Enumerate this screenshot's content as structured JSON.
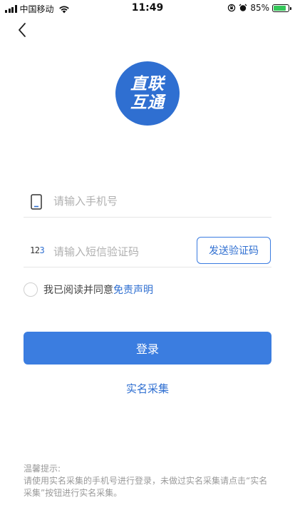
{
  "status_bar": {
    "carrier": "中国移动",
    "time": "11:49",
    "battery": "85%",
    "battery_level": 0.85
  },
  "logo": {
    "text": "直联互通",
    "color": "#2f6fd1"
  },
  "form": {
    "phone_placeholder": "请输入手机号",
    "phone_value": "",
    "sms_placeholder": "请输入短信验证码",
    "sms_value": "",
    "sms_icon_digits": "12",
    "sms_icon_accent": "3",
    "send_code_label": "发送验证码"
  },
  "agreement": {
    "text": "我已阅读并同意",
    "link": "免责声明",
    "checked": false
  },
  "actions": {
    "login_label": "登录",
    "realname_label": "实名采集",
    "accent": "#3b7de0"
  },
  "tips": {
    "title": "温馨提示:",
    "body": "请使用实名采集的手机号进行登录，未做过实名采集请点击“实名采集”按钮进行实名采集。"
  },
  "icons": {
    "back": "chevron-left-icon",
    "phone": "phone-icon",
    "sms": "sms-code-icon",
    "wifi": "wifi-icon",
    "alarm": "alarm-icon",
    "rotation_lock": "rotation-lock-icon"
  }
}
